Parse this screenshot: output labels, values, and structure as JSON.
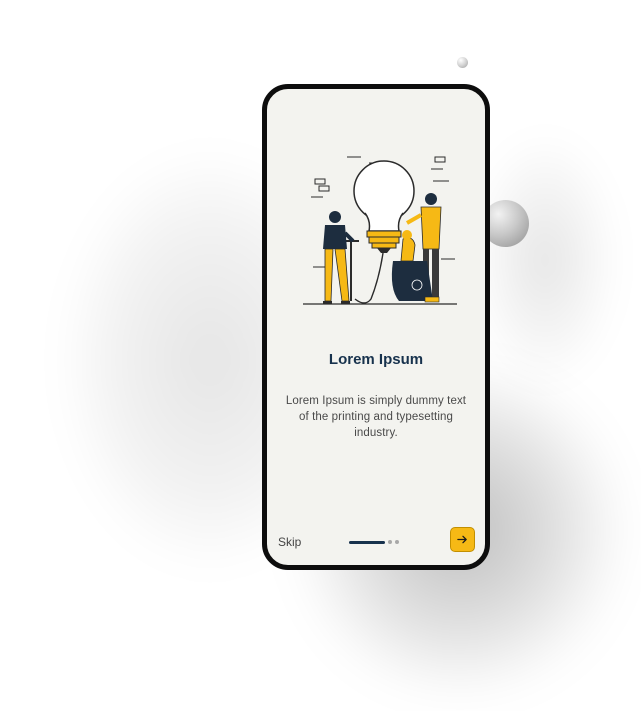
{
  "onboarding": {
    "title": "Lorem Ipsum",
    "description": "Lorem Ipsum is simply dummy text of the printing and typesetting industry.",
    "skip_label": "Skip",
    "next_icon": "arrow-right-icon",
    "page_indicator": {
      "total_pages": 3,
      "current_page": 1
    },
    "illustration": "people-repairing-light-bulb-illustration"
  },
  "colors": {
    "title": "#17324d",
    "accent": "#f6b915",
    "screen_background": "#f3f3ef",
    "frame": "#0d0d0d"
  }
}
